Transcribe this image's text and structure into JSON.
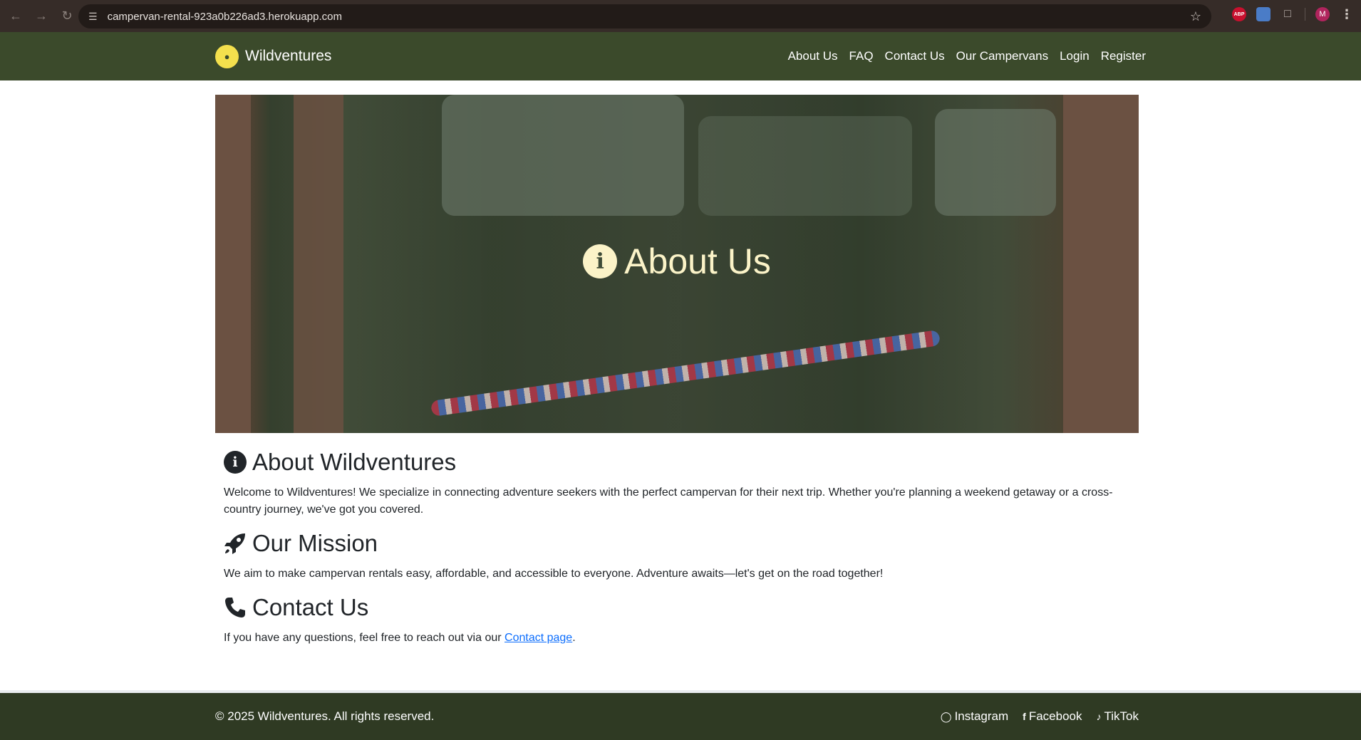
{
  "browser": {
    "url": "campervan-rental-923a0b226ad3.herokuapp.com",
    "extensions": [
      "ABP",
      "image-extension",
      "puzzle-icon"
    ],
    "profile_initial": "M"
  },
  "nav": {
    "brand": "Wildventures",
    "links": [
      "About Us",
      "FAQ",
      "Contact Us",
      "Our Campervans",
      "Login",
      "Register"
    ]
  },
  "hero": {
    "title": "About Us",
    "icon": "info-icon"
  },
  "sections": [
    {
      "heading": "About Wildventures",
      "icon": "info-circle-icon",
      "text": "Welcome to Wildventures! We specialize in connecting adventure seekers with the perfect campervan for their next trip. Whether you're planning a weekend getaway or a cross-country journey, we've got you covered."
    },
    {
      "heading": "Our Mission",
      "icon": "rocket-icon",
      "text": "We aim to make campervan rentals easy, affordable, and accessible to everyone. Adventure awaits—let's get on the road together!"
    },
    {
      "heading": "Contact Us",
      "icon": "phone-icon",
      "text_before": "If you have any questions, feel free to reach out via our ",
      "link_text": "Contact page",
      "text_after": "."
    }
  ],
  "footer": {
    "copyright": "© 2025 Wildventures. All rights reserved.",
    "social": [
      "Instagram",
      "Facebook",
      "TikTok"
    ]
  },
  "colors": {
    "navbar": "#3b4a2b",
    "footer": "#2f3a23",
    "hero_text": "#fbf3c8",
    "link": "#0d6efd"
  }
}
